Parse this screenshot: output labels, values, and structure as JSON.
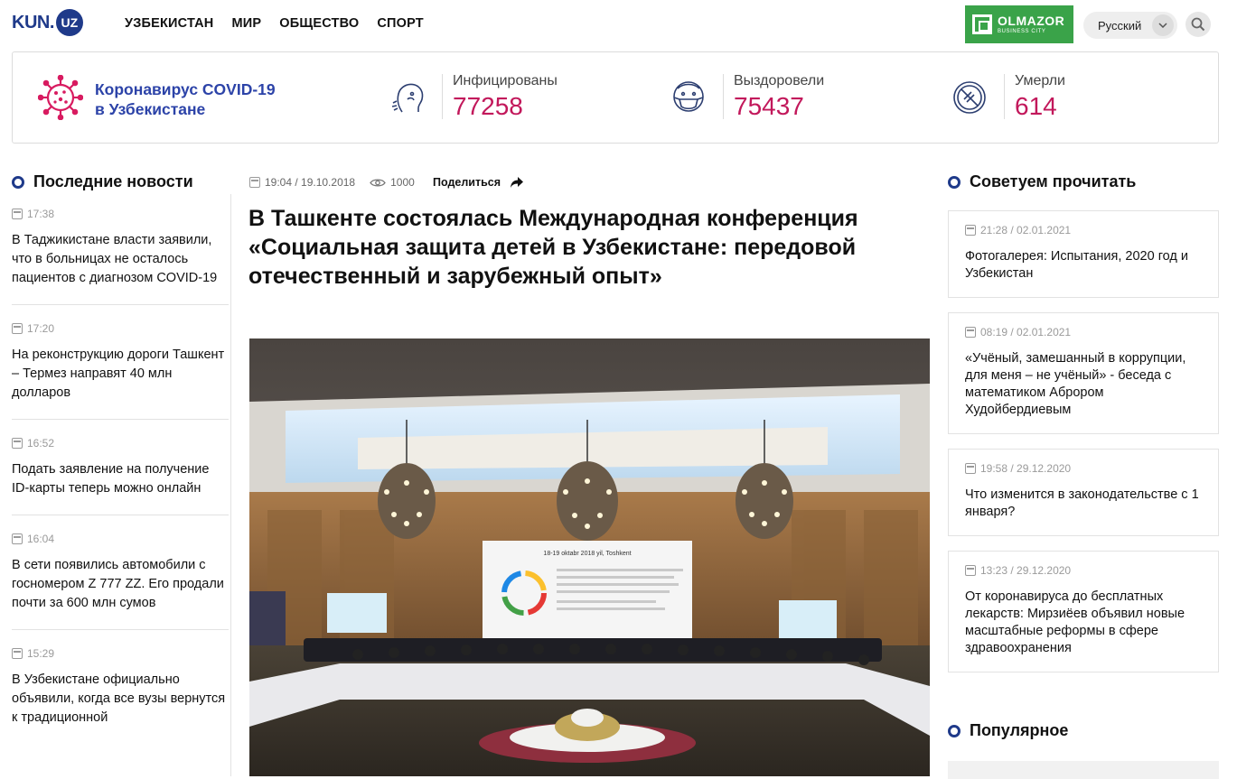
{
  "header": {
    "logo_kun": "KUN.",
    "logo_uz": "UZ",
    "nav": [
      "УЗБЕКИСТАН",
      "МИР",
      "ОБЩЕСТВО",
      "СПОРТ"
    ],
    "ad": {
      "line1": "OLMAZOR",
      "line2": "BUSINESS CITY",
      "color": "#3aa349"
    },
    "language": "Русский",
    "search_icon": "search-icon"
  },
  "covid": {
    "title_line1": "Коронавирус COVID-19",
    "title_line2": "в Узбекистане",
    "stats": [
      {
        "label": "Инфицированы",
        "value": "77258",
        "icon": "infected-icon"
      },
      {
        "label": "Выздоровели",
        "value": "75437",
        "icon": "recovered-icon"
      },
      {
        "label": "Умерли",
        "value": "614",
        "icon": "deaths-icon"
      }
    ]
  },
  "latest": {
    "heading": "Последние новости",
    "items": [
      {
        "time": "17:38",
        "title": "В Таджикистане власти заявили, что в больницах не осталось пациентов с диагнозом COVID-19"
      },
      {
        "time": "17:20",
        "title": "На реконструкцию дороги Ташкент – Термез направят 40 млн долларов"
      },
      {
        "time": "16:52",
        "title": "Подать заявление на получение ID-карты теперь можно онлайн"
      },
      {
        "time": "16:04",
        "title": "В сети появились автомобили с госномером Z 777 ZZ. Его продали почти за 600 млн сумов"
      },
      {
        "time": "15:29",
        "title": "В Узбекистане официально объявили, когда все вузы вернутся к традиционной"
      }
    ]
  },
  "article": {
    "datetime": "19:04 / 19.10.2018",
    "views": "1000",
    "share_label": "Поделиться",
    "title": "В Ташкенте состоялась Международная конференция «Социальная защита детей в Узбекистане: передовой отечественный и зарубежный опыт»",
    "banner_date": "18-19 oktabr 2018 yil, Toshkent"
  },
  "recommended": {
    "heading": "Советуем прочитать",
    "items": [
      {
        "time": "21:28 / 02.01.2021",
        "title": "Фотогалерея: Испытания, 2020 год и Узбекистан"
      },
      {
        "time": "08:19 / 02.01.2021",
        "title": "«Учёный, замешанный в коррупции, для меня – не учёный» - беседа с математиком Аброром Худойбердиевым"
      },
      {
        "time": "19:58 / 29.12.2020",
        "title": "Что изменится в законодательстве с 1 января?"
      },
      {
        "time": "13:23 / 29.12.2020",
        "title": "От коронавируса до бесплатных лекарств: Мирзиёев объявил новые масштабные реформы в сфере здравоохранения"
      }
    ]
  },
  "popular": {
    "heading": "Популярное"
  },
  "colors": {
    "brand": "#1f3a8a",
    "covid_title": "#2c43a8",
    "covid_number": "#c2185b"
  }
}
